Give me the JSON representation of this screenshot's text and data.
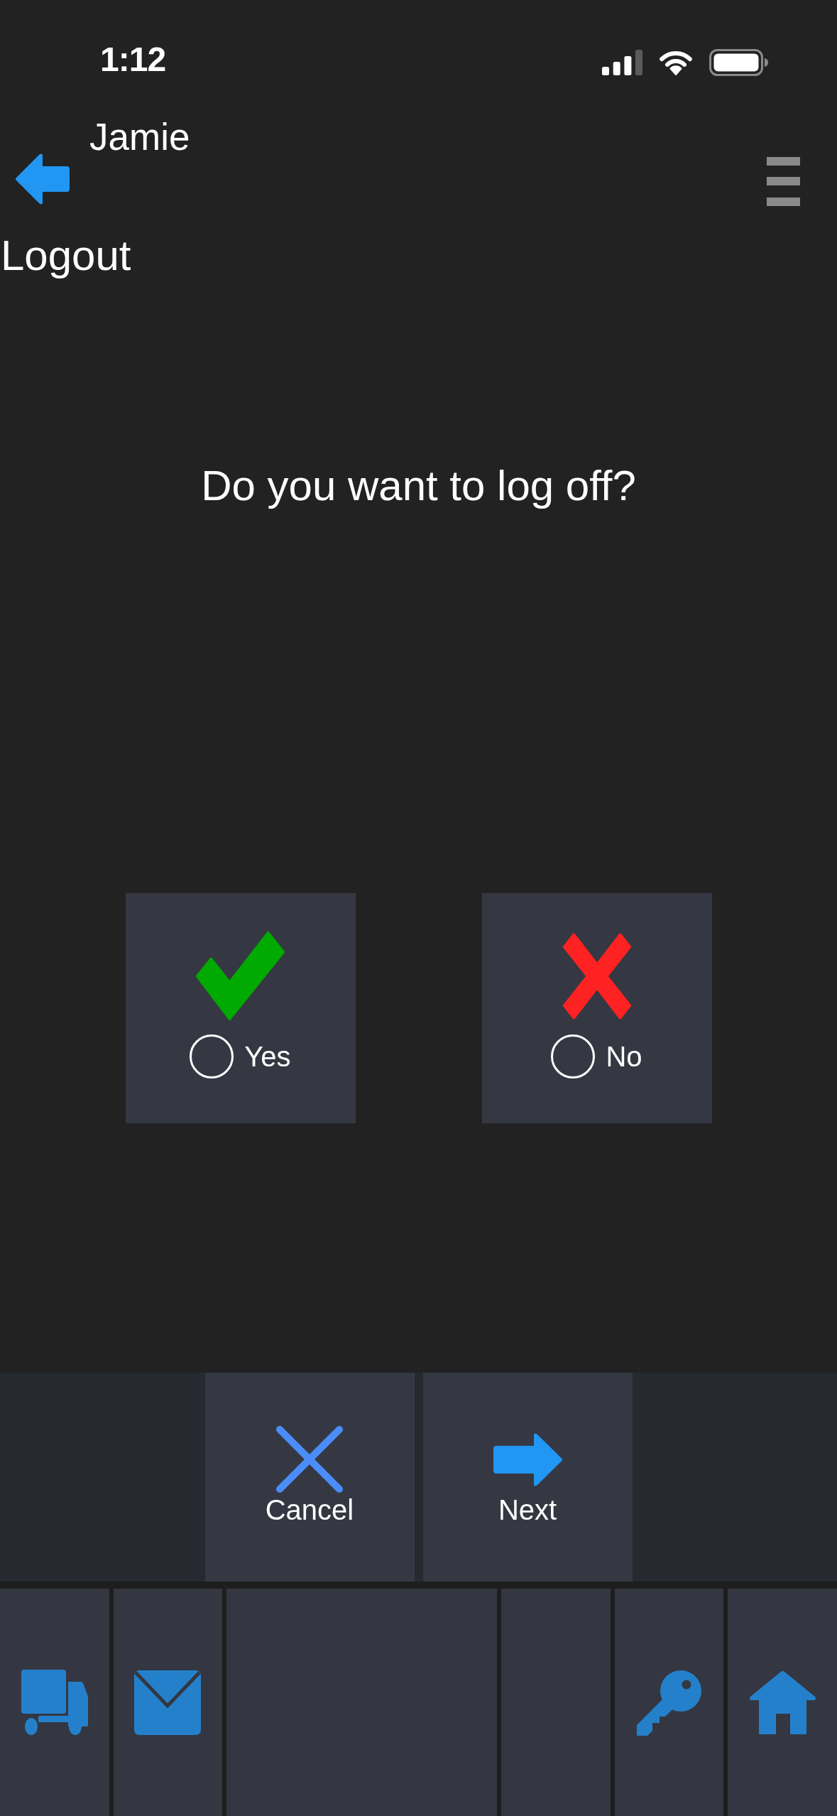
{
  "status_bar": {
    "time": "1:12"
  },
  "header": {
    "user": "Jamie",
    "title": "Logout"
  },
  "question": "Do you want to log off?",
  "options": [
    {
      "kind": "confirm",
      "label": "Yes",
      "selected": false
    },
    {
      "kind": "decline",
      "label": "No",
      "selected": false
    }
  ],
  "actions": [
    {
      "kind": "cancel",
      "label": "Cancel"
    },
    {
      "kind": "next",
      "label": "Next"
    }
  ],
  "tab_bar": [
    {
      "kind": "truck"
    },
    {
      "kind": "mail"
    },
    {
      "kind": "empty"
    },
    {
      "kind": "empty"
    },
    {
      "kind": "key"
    },
    {
      "kind": "home"
    }
  ]
}
